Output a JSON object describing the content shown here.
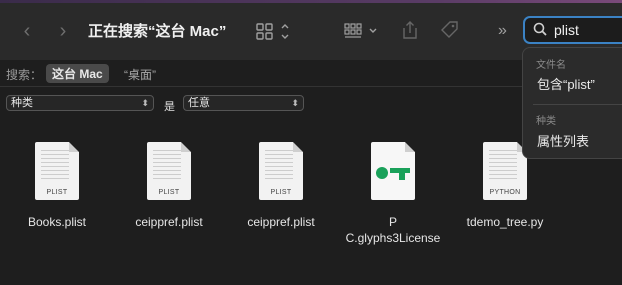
{
  "window": {
    "title": "正在搜索“这台 Mac”"
  },
  "toolbar": {
    "back_icon": "chevron-left-icon",
    "forward_icon": "chevron-right-icon",
    "view_icon": "grid-view-icon",
    "group_icon": "group-by-icon",
    "share_icon": "share-icon",
    "tag_icon": "tag-icon",
    "more_icon": "chevron-double-right-icon"
  },
  "search": {
    "value": "plist",
    "icon": "search-icon"
  },
  "scope": {
    "label": "搜索：",
    "active": "这台 Mac",
    "other": "“桌面”"
  },
  "filter": {
    "kind": "种类",
    "is_label": "是",
    "value": "任意"
  },
  "files": [
    {
      "name": "Books.plist",
      "type": "PLIST"
    },
    {
      "name": "ceippref.plist",
      "type": "PLIST"
    },
    {
      "name": "ceippref.plist",
      "type": "PLIST"
    },
    {
      "name_line1": "P",
      "name_line2": "C.glyphs3License"
    },
    {
      "name": "tdemo_tree.py",
      "type": "PYTHON"
    }
  ],
  "suggestions": {
    "filename_header": "文件名",
    "filename_item": "包含“plist”",
    "kind_header": "种类",
    "kind_item": "属性列表"
  },
  "colors": {
    "accent": "#3b82c4",
    "glyph_green": "#1aa15a"
  }
}
